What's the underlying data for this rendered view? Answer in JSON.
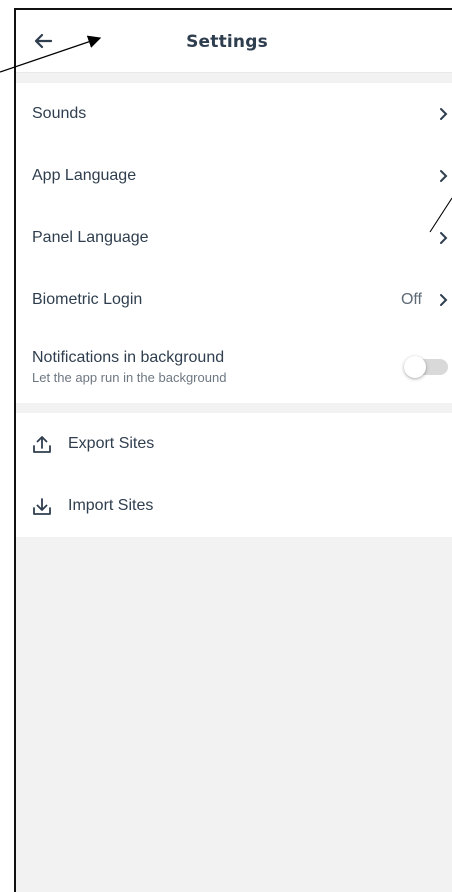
{
  "header": {
    "title": "Settings",
    "back_icon": "arrow-left-icon"
  },
  "settings": [
    {
      "label": "Sounds"
    },
    {
      "label": "App Language"
    },
    {
      "label": "Panel Language"
    },
    {
      "label": "Biometric Login",
      "value": "Off"
    }
  ],
  "notifications": {
    "label": "Notifications in background",
    "sublabel": "Let the app run in the background",
    "enabled": false
  },
  "actions": [
    {
      "label": "Export Sites",
      "icon": "upload-icon"
    },
    {
      "label": "Import Sites",
      "icon": "download-icon"
    }
  ],
  "colors": {
    "text": "#2f3e4e",
    "background": "#f2f2f2",
    "toggle_off": "#d9d9d9"
  }
}
